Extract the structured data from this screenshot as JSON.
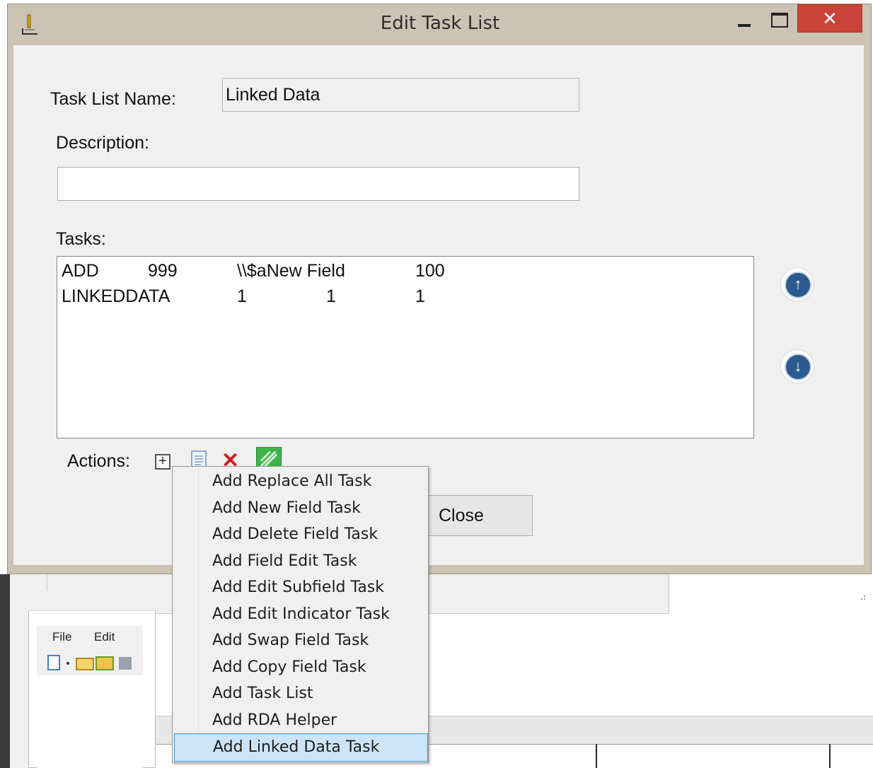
{
  "window": {
    "title": "Edit Task List",
    "close_glyph": "✕"
  },
  "form": {
    "name_label": "Task List Name:",
    "name_value": "Linked Data",
    "description_label": "Description:",
    "description_value": "",
    "tasks_label": "Tasks:",
    "tasks": [
      [
        "ADD",
        "999",
        "\\\\$aNew Field",
        "100"
      ],
      [
        "LINKEDDATA",
        "1",
        "1",
        "1"
      ]
    ],
    "actions_label": "Actions:",
    "close_label": "Close"
  },
  "icons": {
    "add": "+",
    "delete": "✕",
    "up": "↑",
    "down": "↓"
  },
  "context_menu": {
    "items": [
      "Add Replace All Task",
      "Add New Field Task",
      "Add Delete Field Task",
      "Add Field Edit Task",
      "Add Edit Subfield Task",
      "Add Edit Indicator Task",
      "Add Swap Field Task",
      "Add Copy Field Task",
      "Add Task List",
      "Add RDA Helper",
      "Add Linked Data Task"
    ],
    "selected_index": 10
  },
  "background": {
    "menu_file": "File",
    "menu_edit": "Edit"
  }
}
